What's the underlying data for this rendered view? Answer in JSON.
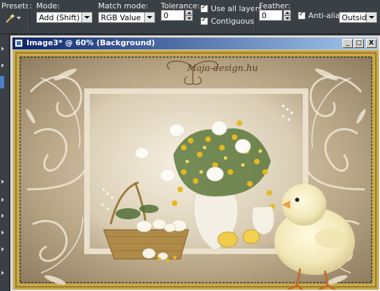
{
  "toolbar": {
    "presets_label": "Presets:",
    "mode_label": "Mode:",
    "mode_value": "Add (Shift)",
    "match_label": "Match mode:",
    "match_value": "RGB Value",
    "tolerance_label": "Tolerance:",
    "tolerance_value": "0",
    "use_all_layers_label": "Use all layers",
    "contiguous_label": "Contiguous",
    "feather_label": "Feather:",
    "feather_value": "0",
    "anti_alias_label": "Anti-alias",
    "outside_value": "Outside"
  },
  "window": {
    "title": "Image3* @  60% (Background)",
    "minimize_glyph": "_",
    "maximize_glyph": "□",
    "close_glyph": "X"
  },
  "image": {
    "watermark": "Maja-design.hu"
  },
  "colors": {
    "titlebar_start": "#0a246a",
    "titlebar_end": "#a6caf0",
    "frame_gold": "#c9a949",
    "background_tan": "#b9a98a"
  },
  "icons": [
    "magic-wand-icon",
    "chevron-down-icon",
    "checkbox-checked-icon",
    "document-icon",
    "minimize-icon",
    "maximize-icon",
    "close-icon"
  ]
}
